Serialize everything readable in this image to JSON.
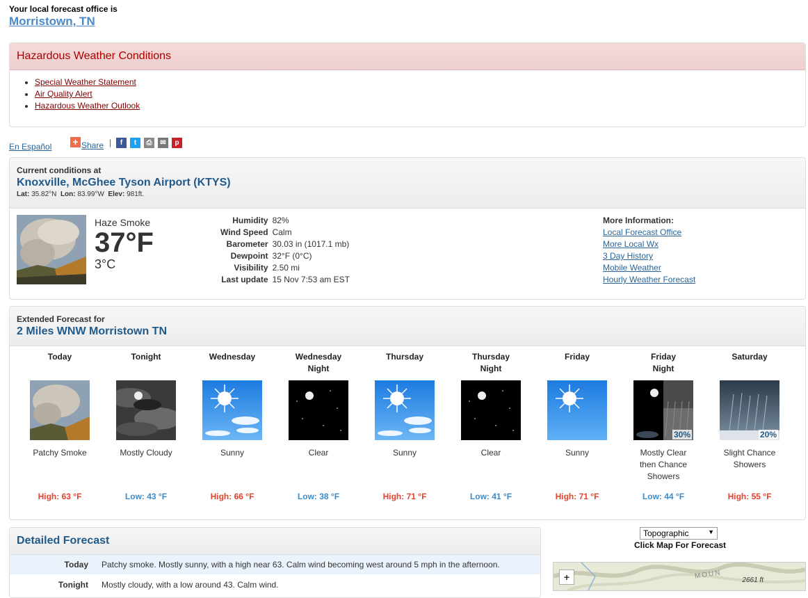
{
  "office": {
    "label": "Your local forecast office is",
    "name": "Morristown, TN"
  },
  "hazards": {
    "title": "Hazardous Weather Conditions",
    "items": [
      "Special Weather Statement",
      "Air Quality Alert",
      "Hazardous Weather Outlook"
    ]
  },
  "share": {
    "espanol": "En Español",
    "share_label": "Share",
    "separator": "|"
  },
  "current": {
    "label": "Current conditions at",
    "station": "Knoxville, McGhee Tyson Airport (KTYS)",
    "lat_label": "Lat:",
    "lat": "35.82°N",
    "lon_label": "Lon:",
    "lon": "83.99°W",
    "elev_label": "Elev:",
    "elev": "981ft.",
    "description": "Haze Smoke",
    "temp_f": "37°F",
    "temp_c": "3°C",
    "details": [
      {
        "key": "Humidity",
        "value": "82%"
      },
      {
        "key": "Wind Speed",
        "value": "Calm"
      },
      {
        "key": "Barometer",
        "value": "30.03 in (1017.1 mb)"
      },
      {
        "key": "Dewpoint",
        "value": "32°F (0°C)"
      },
      {
        "key": "Visibility",
        "value": "2.50 mi"
      },
      {
        "key": "Last update",
        "value": "15 Nov 7:53 am EST"
      }
    ],
    "more_info_title": "More Information:",
    "more_info_links": [
      "Local Forecast Office",
      "More Local Wx",
      "3 Day History",
      "Mobile Weather",
      "Hourly Weather Forecast"
    ]
  },
  "extended": {
    "label": "Extended Forecast for",
    "location": "2 Miles WNW Morristown TN",
    "periods": [
      {
        "name1": "Today",
        "name2": "",
        "icon": "smoke-icon",
        "desc": [
          "Patchy Smoke"
        ],
        "temp": "High: 63 °F",
        "kind": "hi",
        "pop": ""
      },
      {
        "name1": "Tonight",
        "name2": "",
        "icon": "mostly-cloudy-night-icon",
        "desc": [
          "Mostly Cloudy"
        ],
        "temp": "Low: 43 °F",
        "kind": "lo",
        "pop": ""
      },
      {
        "name1": "Wednesday",
        "name2": "",
        "icon": "sunny-icon",
        "desc": [
          "Sunny"
        ],
        "temp": "High: 66 °F",
        "kind": "hi",
        "pop": ""
      },
      {
        "name1": "Wednesday",
        "name2": "Night",
        "icon": "clear-night-icon",
        "desc": [
          "Clear"
        ],
        "temp": "Low: 38 °F",
        "kind": "lo",
        "pop": ""
      },
      {
        "name1": "Thursday",
        "name2": "",
        "icon": "sunny-icon",
        "desc": [
          "Sunny"
        ],
        "temp": "High: 71 °F",
        "kind": "hi",
        "pop": ""
      },
      {
        "name1": "Thursday",
        "name2": "Night",
        "icon": "clear-night-icon",
        "desc": [
          "Clear"
        ],
        "temp": "Low: 41 °F",
        "kind": "lo",
        "pop": ""
      },
      {
        "name1": "Friday",
        "name2": "",
        "icon": "sunny-clear-icon",
        "desc": [
          "Sunny"
        ],
        "temp": "High: 71 °F",
        "kind": "hi",
        "pop": ""
      },
      {
        "name1": "Friday",
        "name2": "Night",
        "icon": "clear-then-showers-icon",
        "desc": [
          "Mostly Clear",
          "then Chance",
          "Showers"
        ],
        "temp": "Low: 44 °F",
        "kind": "lo",
        "pop": "30%"
      },
      {
        "name1": "Saturday",
        "name2": "",
        "icon": "rain-showers-icon",
        "desc": [
          "Slight Chance",
          "Showers"
        ],
        "temp": "High: 55 °F",
        "kind": "hi",
        "pop": "20%"
      }
    ]
  },
  "detailed": {
    "title": "Detailed Forecast",
    "rows": [
      {
        "period": "Today",
        "text": "Patchy smoke. Mostly sunny, with a high near 63. Calm wind becoming west around 5 mph in the afternoon."
      },
      {
        "period": "Tonight",
        "text": "Mostly cloudy, with a low around 43. Calm wind."
      }
    ]
  },
  "map": {
    "select_value": "Topographic",
    "caption": "Click Map For Forecast",
    "zoom_label": "+",
    "elevation": "2661 ft",
    "region_label": "MOUN"
  },
  "colors": {
    "hazard_red": "#aa0000",
    "link_blue": "#2a6496",
    "high": "#e3432c",
    "low": "#3d8ac8"
  }
}
